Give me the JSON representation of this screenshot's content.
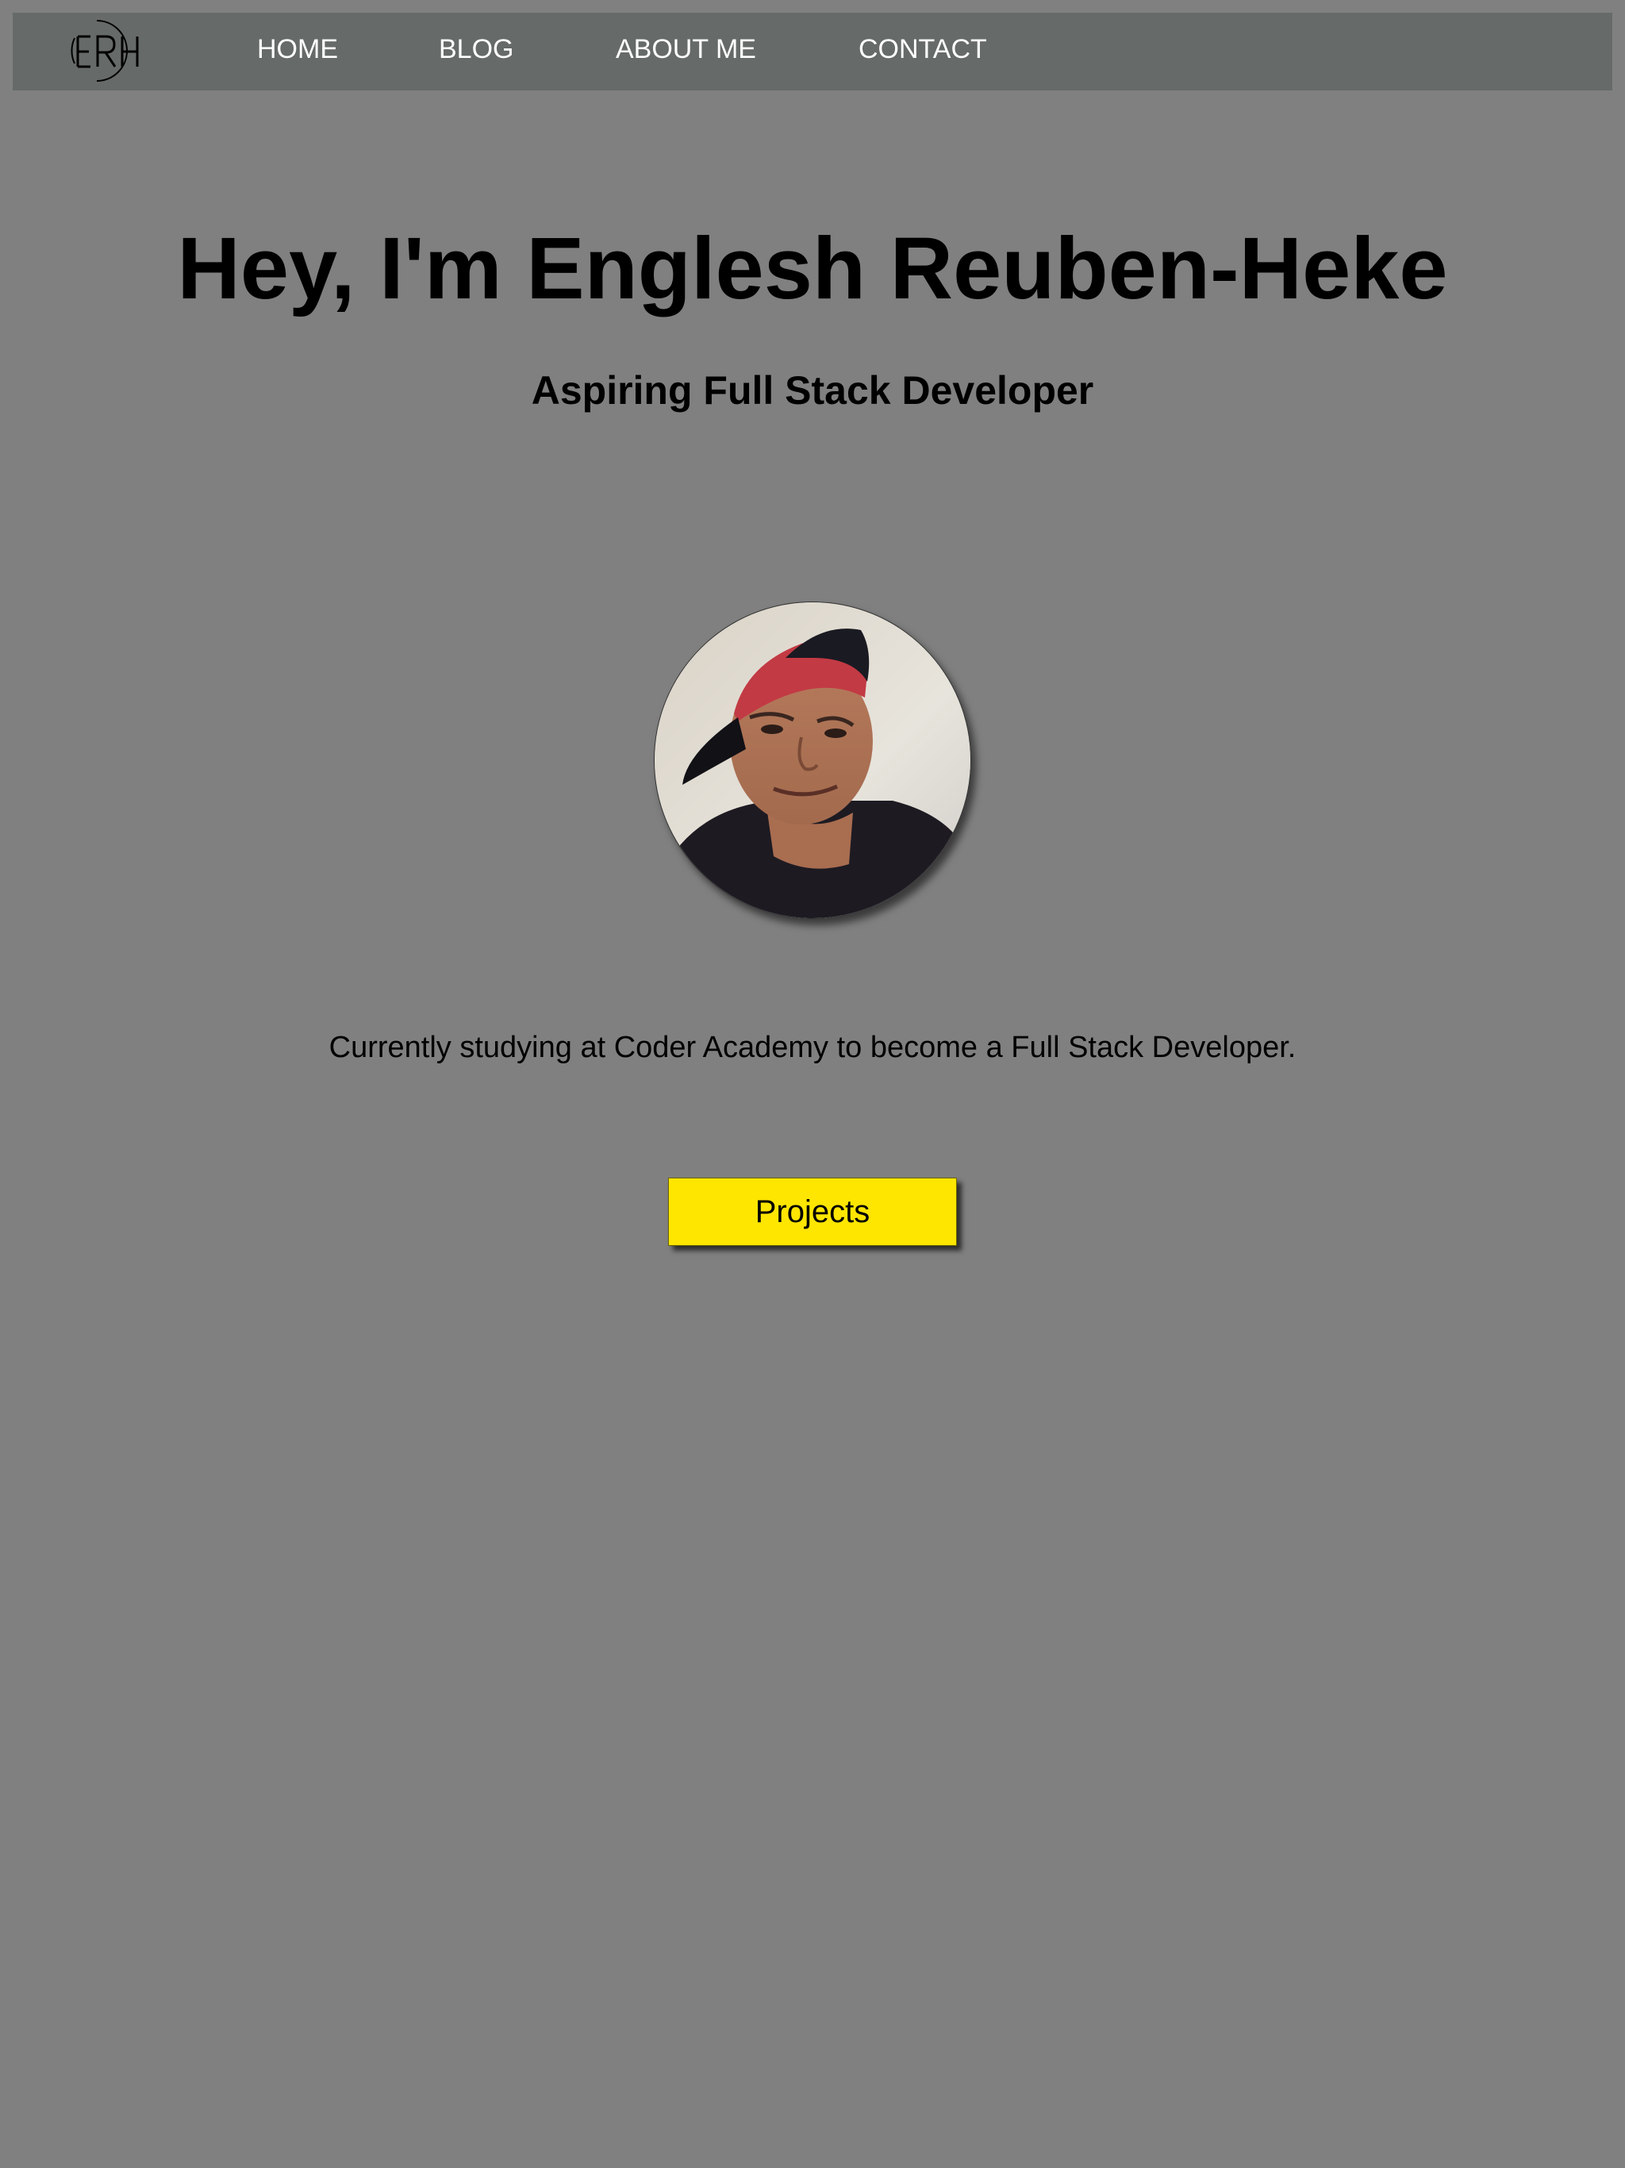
{
  "nav": {
    "logo_text": "ERH",
    "links": [
      {
        "label": "HOME"
      },
      {
        "label": "BLOG"
      },
      {
        "label": "ABOUT ME"
      },
      {
        "label": "CONTACT"
      }
    ]
  },
  "hero": {
    "title": "Hey, I'm Englesh Reuben-Heke",
    "subtitle": "Aspiring Full Stack Developer"
  },
  "intro": {
    "text": "Currently studying at Coder Academy to become a Full Stack Developer."
  },
  "cta": {
    "label": "Projects"
  },
  "colors": {
    "page_background": "#808080",
    "navbar_background": "#666a69",
    "nav_text": "#ffffff",
    "button_background": "#ffe600",
    "text": "#000000"
  }
}
